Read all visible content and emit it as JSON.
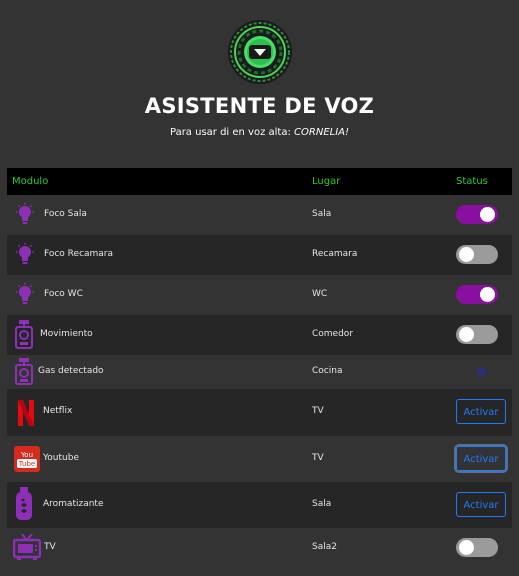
{
  "header": {
    "title": "ASISTENTE DE VOZ",
    "subtitle_prefix": "Para usar di en voz alta: ",
    "subtitle_keyword": "CORNELIA!"
  },
  "table": {
    "headers": {
      "module": "Modulo",
      "place": "Lugar",
      "status": "Status"
    },
    "rows": [
      {
        "name": "Foco Sala",
        "place": "Sala",
        "icon": "lightbulb-icon",
        "control": "toggle",
        "state": "on"
      },
      {
        "name": "Foco Recamara",
        "place": "Recamara",
        "icon": "lightbulb-icon",
        "control": "toggle",
        "state": "off"
      },
      {
        "name": "Foco WC",
        "place": "WC",
        "icon": "lightbulb-icon",
        "control": "toggle",
        "state": "on"
      },
      {
        "name": "Movimiento",
        "place": "Comedor",
        "icon": "motion-sensor-icon",
        "control": "toggle",
        "state": "off"
      },
      {
        "name": "Gas detectado",
        "place": "Cocina",
        "icon": "gas-sensor-icon",
        "control": "indicator",
        "state": "off"
      },
      {
        "name": "Netflix",
        "place": "TV",
        "icon": "netflix-icon",
        "control": "button",
        "label": "Activar"
      },
      {
        "name": "Youtube",
        "place": "TV",
        "icon": "youtube-icon",
        "control": "button",
        "label": "Activar"
      },
      {
        "name": "Aromatizante",
        "place": "Sala",
        "icon": "air-freshener-icon",
        "control": "button",
        "label": "Activar"
      },
      {
        "name": "TV",
        "place": "Sala2",
        "icon": "tv-icon",
        "control": "toggle",
        "state": "off"
      }
    ]
  },
  "colors": {
    "background": "#333333",
    "header_green": "#2ecc2e",
    "toggle_on": "#8a0fa0",
    "toggle_off": "#9b9b9b",
    "button_blue": "#1e7cff",
    "icon_purple": "#8e2fb8"
  }
}
